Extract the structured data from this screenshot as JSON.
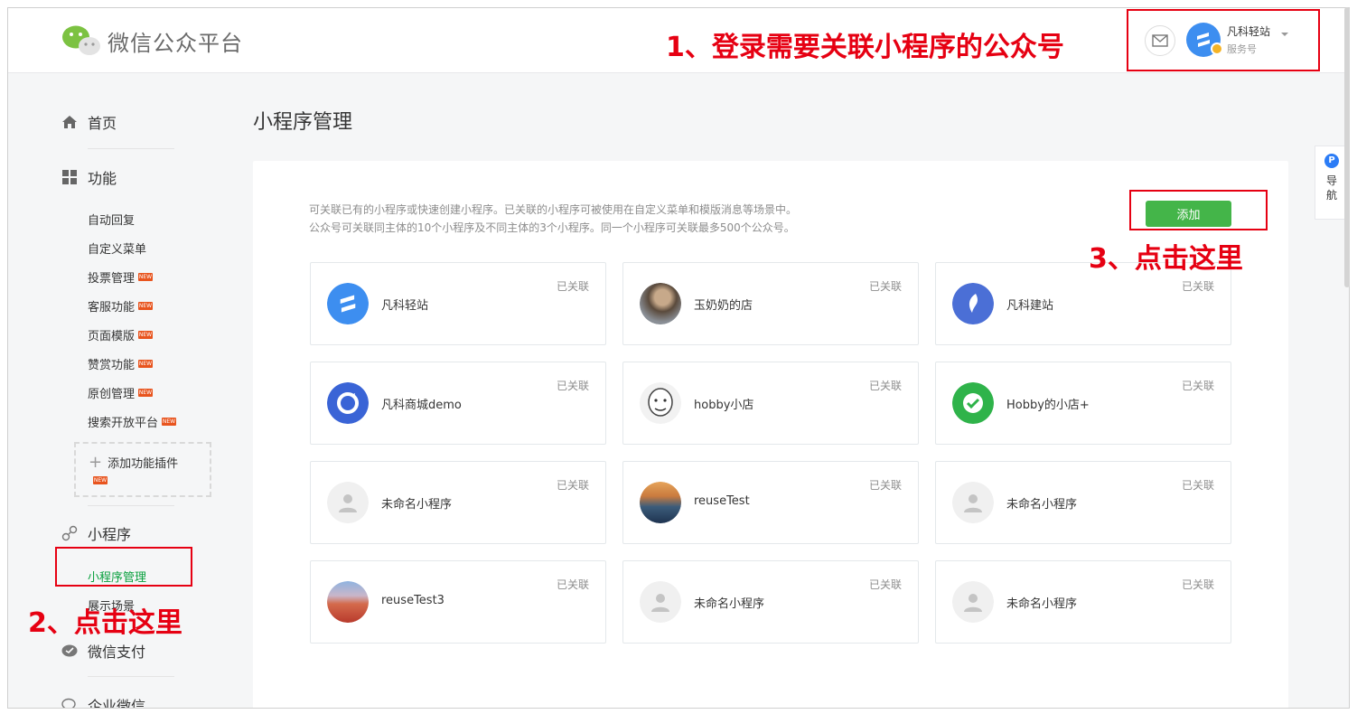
{
  "header": {
    "logo_text": "微信公众平台",
    "account_name": "凡科轻站",
    "account_type": "服务号"
  },
  "sidebar": {
    "home": "首页",
    "features": "功能",
    "feature_items": [
      {
        "label": "自动回复",
        "new": false
      },
      {
        "label": "自定义菜单",
        "new": false
      },
      {
        "label": "投票管理",
        "new": true
      },
      {
        "label": "客服功能",
        "new": true
      },
      {
        "label": "页面模版",
        "new": true
      },
      {
        "label": "赞赏功能",
        "new": true
      },
      {
        "label": "原创管理",
        "new": true
      },
      {
        "label": "搜索开放平台",
        "new": true
      }
    ],
    "add_plugin": "添加功能插件",
    "new_tag": "NEW",
    "miniprogram": "小程序",
    "miniprogram_manage": "小程序管理",
    "showcase": "展示场景",
    "wechat_pay": "微信支付",
    "enterprise_wechat": "企业微信"
  },
  "main": {
    "title": "小程序管理",
    "desc_line1": "可关联已有的小程序或快速创建小程序。已关联的小程序可被使用在自定义菜单和模版消息等场景中。",
    "desc_line2": "公众号可关联同主体的10个小程序及不同主体的3个小程序。同一个小程序可关联最多500个公众号。",
    "add_button": "添加",
    "status_label": "已关联",
    "cards": [
      {
        "name": "凡科轻站",
        "avatar": "fanke-lightsite-icon"
      },
      {
        "name": "玉奶奶的店",
        "avatar": "photo-avatar"
      },
      {
        "name": "凡科建站",
        "avatar": "fanke-site-icon"
      },
      {
        "name": "凡科商城demo",
        "avatar": "fanke-mall-icon"
      },
      {
        "name": "hobby小店",
        "avatar": "meme-face-avatar"
      },
      {
        "name": "Hobby的小店+",
        "avatar": "green-chat-icon"
      },
      {
        "name": "未命名小程序",
        "avatar": "default-user-icon"
      },
      {
        "name": "reuseTest",
        "avatar": "city-photo-avatar"
      },
      {
        "name": "未命名小程序",
        "avatar": "default-user-icon"
      },
      {
        "name": "reuseTest3",
        "avatar": "flowers-photo-avatar"
      },
      {
        "name": "未命名小程序",
        "avatar": "default-user-icon"
      },
      {
        "name": "未命名小程序",
        "avatar": "default-user-icon"
      }
    ]
  },
  "float_nav": {
    "badge": "P",
    "label": "导航"
  },
  "annotations": {
    "step1": "1、登录需要关联小程序的公众号",
    "step2": "2、点击这里",
    "step3": "3、点击这里"
  },
  "colors": {
    "accent_green": "#44b549",
    "active_nav": "#09a03e",
    "annotation_red": "#e60012"
  }
}
